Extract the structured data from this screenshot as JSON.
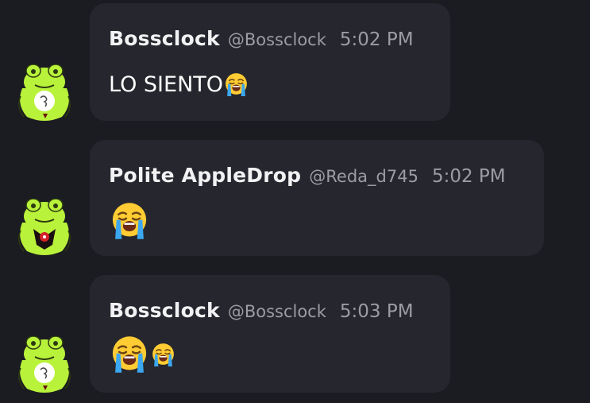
{
  "messages": [
    {
      "author": "Bossclock",
      "handle": "@Bossclock",
      "time": "5:02 PM",
      "text": "LO SIENTO",
      "emoji": [
        "loudly-crying-face"
      ],
      "avatar": "frog-avatar-note"
    },
    {
      "author": "Polite AppleDrop",
      "handle": "@Reda_d745",
      "time": "5:02 PM",
      "text": "",
      "emoji": [
        "loudly-crying-face"
      ],
      "avatar": "frog-avatar-badge"
    },
    {
      "author": "Bossclock",
      "handle": "@Bossclock",
      "time": "5:03 PM",
      "text": "",
      "emoji": [
        "loudly-crying-face",
        "loudly-crying-face"
      ],
      "avatar": "frog-avatar-note"
    }
  ],
  "colors": {
    "background": "#1b1c21",
    "bubble": "#26272e",
    "author": "#f2f2f4",
    "meta": "#9b9ca4",
    "frog": "#b9f23a"
  }
}
